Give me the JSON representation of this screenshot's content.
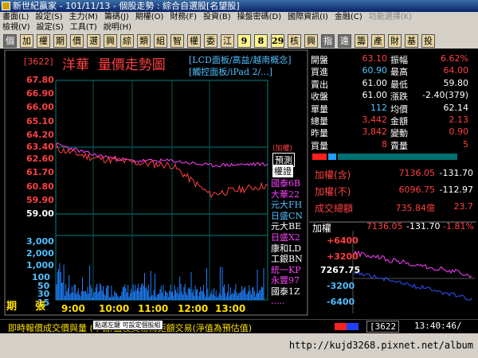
{
  "titlebar": {
    "title": "新世紀贏家 - 101/11/13 - 個股走勢 : 綜合自選股[名望股]"
  },
  "menu": {
    "row1": [
      "畫面(L)",
      "設定(S)",
      "主力(M)",
      "籌碼(J)",
      "期權(O)",
      "財務(F)",
      "投資(B)",
      "操盤密碼(D)",
      "國際資訊(I)",
      "金融(C)",
      "功能選擇(K)"
    ],
    "row2": [
      "檢視(V)",
      "設定(S)",
      "工具(T)",
      "說明(H)"
    ]
  },
  "toolbar": {
    "buttons": [
      "個",
      "加",
      "權",
      "期",
      "價",
      "選",
      "興",
      "綜",
      "類",
      "組",
      "智",
      "權",
      "委",
      "江"
    ],
    "nums": [
      "9",
      "8",
      "29"
    ],
    "tail": [
      "核",
      "興",
      "指",
      "遠",
      "籌",
      "產",
      "財",
      "基",
      "投"
    ]
  },
  "stock": {
    "code": "[3622]",
    "name": "洋華",
    "chart_title": "量價走勢圖",
    "tag1": "[LCD面板/高益/越南概念]",
    "tag2": "[觸控面板/iPad 2/...]"
  },
  "price_axis": [
    "67.80",
    "66.90",
    "66.00",
    "65.10",
    "64.20",
    "63.40",
    "62.60",
    "61.70",
    "60.80",
    "59.90",
    "59.00"
  ],
  "volume_axis": [
    "3,000",
    "2,000",
    "1,000",
    "100",
    "50",
    "30",
    "15"
  ],
  "vol_label": [
    "期",
    "張"
  ],
  "time_axis": [
    "9:00",
    "10:00",
    "11:00",
    "12:00",
    "13:00"
  ],
  "chart_labels": {
    "jiaquan": "(加權)",
    "yuce": "預測",
    "quanzheng": "權證"
  },
  "brokers": [
    {
      "name": "國泰6B",
      "color": "#ff40ff"
    },
    {
      "name": "大華22",
      "color": "#ff40ff"
    },
    {
      "name": "元大FH",
      "color": "#50c0ff"
    },
    {
      "name": "日盛CN",
      "color": "#50c0ff"
    },
    {
      "name": "元大BE",
      "color": "#ffffff"
    },
    {
      "name": "日盛X2",
      "color": "#ff40ff"
    },
    {
      "name": "康和LD",
      "color": "#ffffff"
    },
    {
      "name": "工銀BN",
      "color": "#ffffff"
    },
    {
      "name": "統一KP",
      "color": "#ff40ff"
    },
    {
      "name": "永豐97",
      "color": "#ff40ff"
    },
    {
      "name": "國泰1Z",
      "color": "#ffffff"
    },
    {
      "name": ".....",
      "color": "#ff40ff"
    }
  ],
  "quote": [
    {
      "l1": "開盤",
      "v1": "63.10",
      "c1": "#ff4040",
      "l2": "振幅",
      "v2": "6.62%",
      "c2": "#ff4040"
    },
    {
      "l1": "買進",
      "v1": "60.90",
      "c1": "#50c0ff",
      "l2": "最高",
      "v2": "64.00",
      "c2": "#ff4040"
    },
    {
      "l1": "賣出",
      "v1": "61.00",
      "c1": "#ffffff",
      "l2": "最低",
      "v2": "59.80",
      "c2": "#ffffff"
    },
    {
      "l1": "收盤",
      "v1": "61.00",
      "c1": "#ffffff",
      "l2": "漲跌",
      "v2": "-2.40(379)",
      "c2": "#ffffff"
    },
    {
      "l1": "單量",
      "v1": "112",
      "c1": "#50c0ff",
      "l2": "均價",
      "v2": "62.14",
      "c2": "#ffffff"
    },
    {
      "l1": "總量",
      "v1": "3,442",
      "c1": "#ff4040",
      "l2": "金額",
      "v2": "2.13",
      "c2": "#ff4040"
    },
    {
      "l1": "昨量",
      "v1": "3,842",
      "c1": "#ff4040",
      "l2": "變動",
      "v2": "0.90",
      "c2": "#ff4040"
    },
    {
      "l1": "買量",
      "v1": "8",
      "c1": "#ff4040",
      "l2": "賣量",
      "v2": "5",
      "c2": "#ff4040"
    }
  ],
  "index": [
    {
      "label": "加權(含)",
      "value": "7136.05",
      "change": "-131.70"
    },
    {
      "label": "加權(不)",
      "value": "6096.75",
      "change": "-112.97"
    },
    {
      "label": "成交總額",
      "value": "735.84億",
      "change": "23.7"
    }
  ],
  "mini": {
    "label": "加權",
    "value": "7136.05",
    "change": "-131.70",
    "pct": "-1.81%",
    "axis": [
      "+6400",
      "+3200",
      "7267.75",
      "-3200",
      "-6400"
    ]
  },
  "status": {
    "code": "[3622",
    "time": "13:40:46/",
    "popup": "點選左鍵 可設定個股組"
  },
  "footer": {
    "text": "即時報價成交價與量 (平日/盤後交易為鉅額交易(淨值為預估值)",
    "url": "http://kujd3268.pixnet.net/album"
  },
  "chart_data": {
    "type": "line",
    "title": "量價走勢圖",
    "x": [
      "9:00",
      "10:00",
      "11:00",
      "12:00",
      "13:00",
      "13:30"
    ],
    "series": [
      {
        "name": "",
        "values": [
          63.3,
          62.7,
          62.4,
          62.2,
          60.3,
          60.9
        ]
      },
      {
        "name": "加權",
        "values": [
          63.6,
          62.9,
          62.5,
          62.5,
          62.2,
          62.3
        ]
      }
    ],
    "ylim": [
      59.0,
      67.8
    ]
  },
  "colors": {
    "up": "#ff4040",
    "down": "#50c0ff",
    "accent": "#ffe000",
    "grid": "#008080"
  }
}
